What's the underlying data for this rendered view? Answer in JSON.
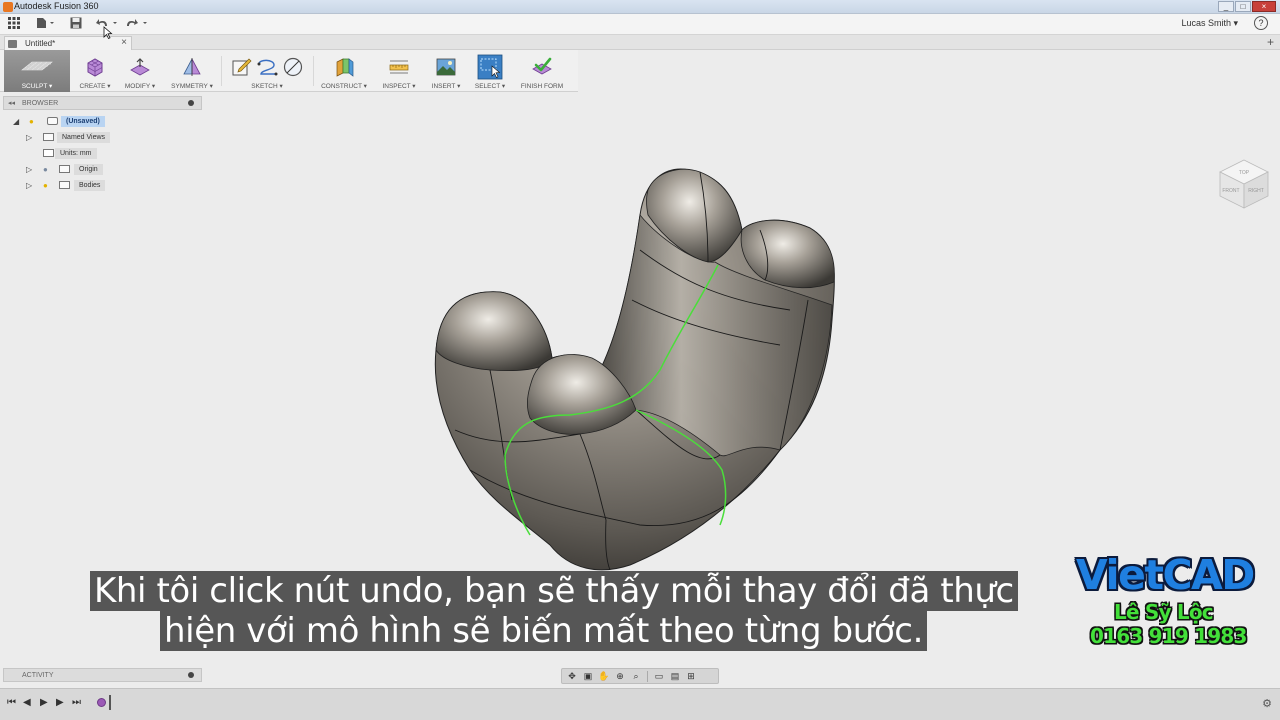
{
  "window": {
    "title": "Autodesk Fusion 360",
    "controls": [
      "_",
      "□",
      "×"
    ]
  },
  "quick_access": {
    "user": "Lucas Smith ▾",
    "help": "?"
  },
  "doc_tab": {
    "name": "Untitled*",
    "close": "×",
    "add": "+"
  },
  "ribbon": {
    "workspace": "SCULPT ▾",
    "groups": {
      "create": "CREATE ▾",
      "modify": "MODIFY ▾",
      "symmetry": "SYMMETRY ▾",
      "sketch": "SKETCH ▾",
      "construct": "CONSTRUCT ▾",
      "inspect": "INSPECT ▾",
      "insert": "INSERT ▾",
      "select": "SELECT ▾",
      "finish": "FINISH FORM"
    }
  },
  "browser": {
    "header": "BROWSER",
    "root": "(Unsaved)",
    "named_views": "Named Views",
    "units": "Units: mm",
    "origin": "Origin",
    "bodies": "Bodies"
  },
  "activity": {
    "header": "ACTIVITY"
  },
  "subtitles": {
    "line1": "Khi tôi click nút undo, bạn sẽ thấy mỗi thay đổi đã thực",
    "line2": "hiện với mô hình sẽ biến mất theo từng bước."
  },
  "watermark": {
    "brand": "VietCAD",
    "name": "Lê Sỹ Lộc",
    "phone": "0163 919 1983"
  },
  "colors": {
    "ribbon_active": "#8a8a8a",
    "selection": "#b9d4f2",
    "edge_highlight": "#4ade3a",
    "watermark_blue": "#1f7fe0",
    "watermark_green": "#43e03a"
  }
}
